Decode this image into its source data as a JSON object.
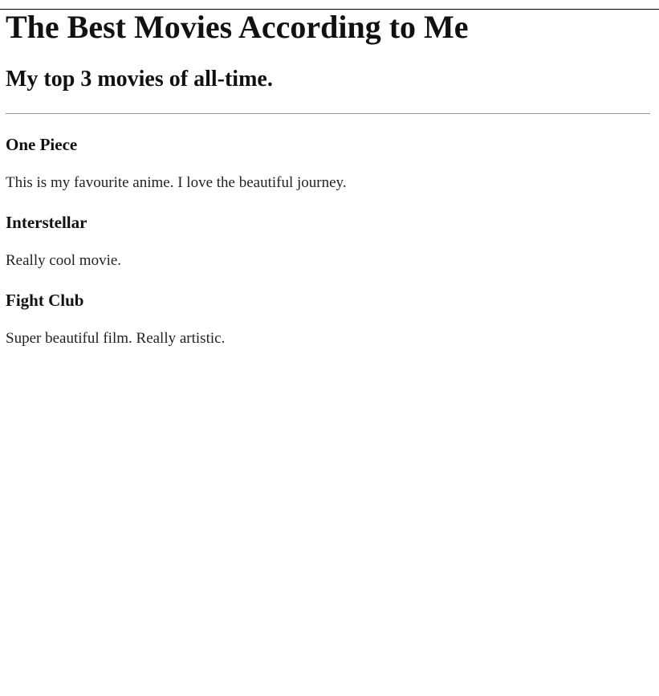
{
  "page": {
    "title": "The Best Movies According to Me",
    "subtitle": "My top 3 movies of all-time."
  },
  "movies": [
    {
      "title": "One Piece",
      "description": "This is my favourite anime. I love the beautiful journey."
    },
    {
      "title": "Interstellar",
      "description": "Really cool movie."
    },
    {
      "title": "Fight Club",
      "description": "Super beautiful film. Really artistic."
    }
  ]
}
